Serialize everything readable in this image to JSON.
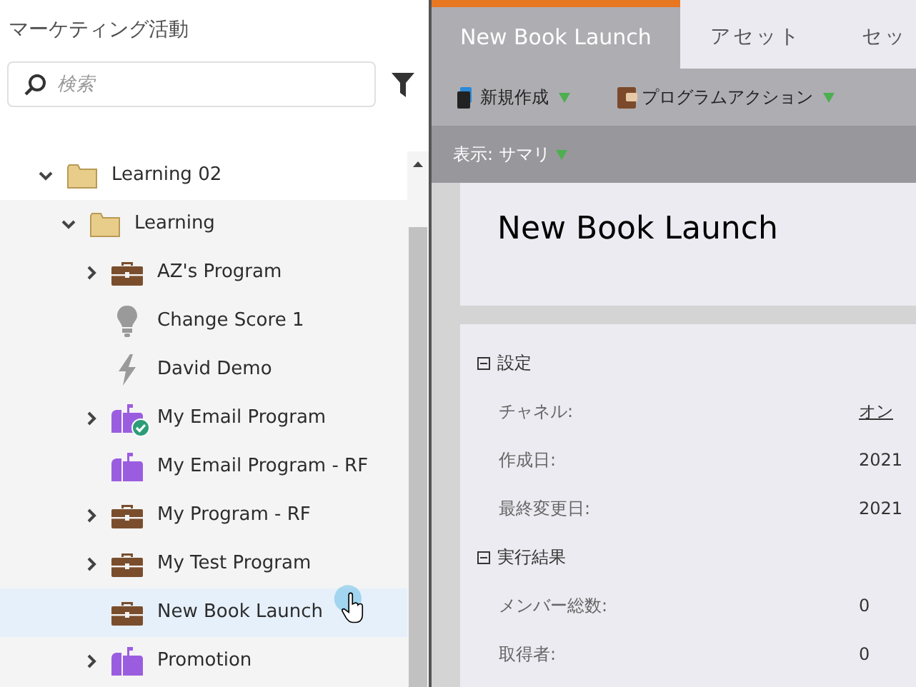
{
  "sidebar": {
    "title": "マーケティング活動",
    "search": {
      "placeholder": "検索"
    },
    "tree": [
      {
        "label": "Learning 02",
        "kind": "folder",
        "expandable": true,
        "expanded": true,
        "approved": false,
        "selected": false,
        "children": [
          {
            "label": "Learning",
            "kind": "folder",
            "expandable": true,
            "expanded": true,
            "approved": false,
            "selected": false,
            "children": [
              {
                "label": "AZ's Program",
                "kind": "program",
                "expandable": true,
                "expanded": false,
                "approved": false,
                "selected": false
              },
              {
                "label": "Change Score 1",
                "kind": "campaign",
                "expandable": false,
                "approved": false,
                "selected": false
              },
              {
                "label": "David Demo",
                "kind": "trigger",
                "expandable": false,
                "approved": false,
                "selected": false
              },
              {
                "label": "My Email Program",
                "kind": "email",
                "expandable": true,
                "expanded": false,
                "approved": true,
                "selected": false
              },
              {
                "label": "My Email Program - RF",
                "kind": "email",
                "expandable": false,
                "approved": false,
                "selected": false
              },
              {
                "label": "My Program - RF",
                "kind": "program",
                "expandable": true,
                "expanded": false,
                "approved": false,
                "selected": false
              },
              {
                "label": "My Test Program",
                "kind": "program",
                "expandable": true,
                "expanded": false,
                "approved": false,
                "selected": false
              },
              {
                "label": "New Book Launch",
                "kind": "program",
                "expandable": false,
                "approved": false,
                "selected": true
              },
              {
                "label": "Promotion",
                "kind": "email",
                "expandable": true,
                "expanded": false,
                "approved": false,
                "selected": false
              }
            ]
          }
        ]
      }
    ]
  },
  "main": {
    "tabs": [
      {
        "label": "New Book Launch",
        "selected": true
      },
      {
        "label": "アセット",
        "selected": false
      },
      {
        "label": "セッ",
        "selected": false
      }
    ],
    "toolbar": [
      {
        "label": "新規作成",
        "kind": "new"
      },
      {
        "label": "プログラムアクション",
        "kind": "program"
      }
    ],
    "view": "表示: サマリ",
    "heading": "New Book Launch",
    "sections": [
      {
        "title": "設定",
        "expanded": true,
        "rows": [
          {
            "label": "チャネル:",
            "value": "オン",
            "kind": "link"
          },
          {
            "label": "作成日:",
            "value": "2021",
            "kind": "text"
          },
          {
            "label": "最終変更日:",
            "value": "2021",
            "kind": "text"
          }
        ]
      },
      {
        "title": "実行結果",
        "expanded": true,
        "rows": [
          {
            "label": "メンバー総数:",
            "value": "0",
            "kind": "text"
          },
          {
            "label": "取得者:",
            "value": "0",
            "kind": "text"
          }
        ]
      }
    ]
  }
}
